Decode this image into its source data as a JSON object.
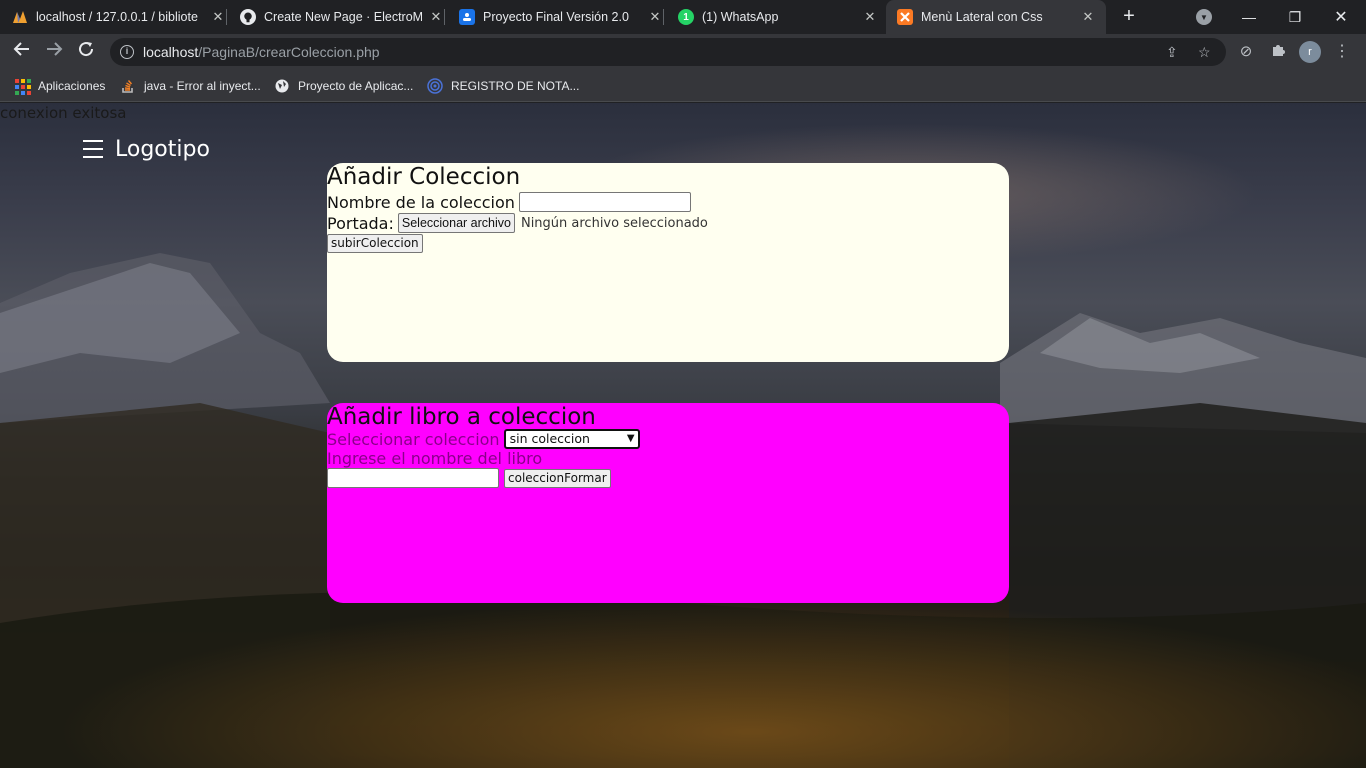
{
  "browser": {
    "tabs": [
      {
        "title": "localhost / 127.0.0.1 / bibliote",
        "icon": "phpmyadmin-icon",
        "active": false
      },
      {
        "title": "Create New Page · ElectroMa",
        "icon": "github-icon",
        "active": false
      },
      {
        "title": "Proyecto Final Versión 2.0",
        "icon": "google-classroom-icon",
        "active": false
      },
      {
        "title": "(1) WhatsApp",
        "icon": "whatsapp-icon",
        "active": false
      },
      {
        "title": "Menù Lateral con Css",
        "icon": "xampp-icon",
        "active": true
      }
    ],
    "url_host": "localhost",
    "url_path": "/PaginaB/crearColeccion.php",
    "bookmarks": [
      {
        "label": "Aplicaciones",
        "icon": "apps-grid-icon"
      },
      {
        "label": "java - Error al inyect...",
        "icon": "stackoverflow-icon"
      },
      {
        "label": "Proyecto de Aplicac...",
        "icon": "globe-icon"
      },
      {
        "label": "REGISTRO DE NOTA...",
        "icon": "registro-icon"
      }
    ],
    "profile_initial": "r"
  },
  "page": {
    "status_message": "conexion exitosa",
    "logo": "Logotipo",
    "colors": {
      "panel_1_bg": "#fffff0",
      "panel_2_bg": "#ff00ff"
    }
  },
  "form_coleccion": {
    "title": "Añadir Coleccion",
    "name_label": "Nombre de la coleccion",
    "name_value": "",
    "cover_label": "Portada:",
    "file_button": "Seleccionar archivo",
    "file_status": "Ningún archivo seleccionado",
    "submit_label": "subirColeccion"
  },
  "form_libro": {
    "title": "Añadir libro a coleccion",
    "select_label": "Seleccionar coleccion",
    "select_value": "sin coleccion",
    "book_label": "Ingrese el nombre del libro",
    "book_value": "",
    "submit_label": "coleccionFormar"
  }
}
